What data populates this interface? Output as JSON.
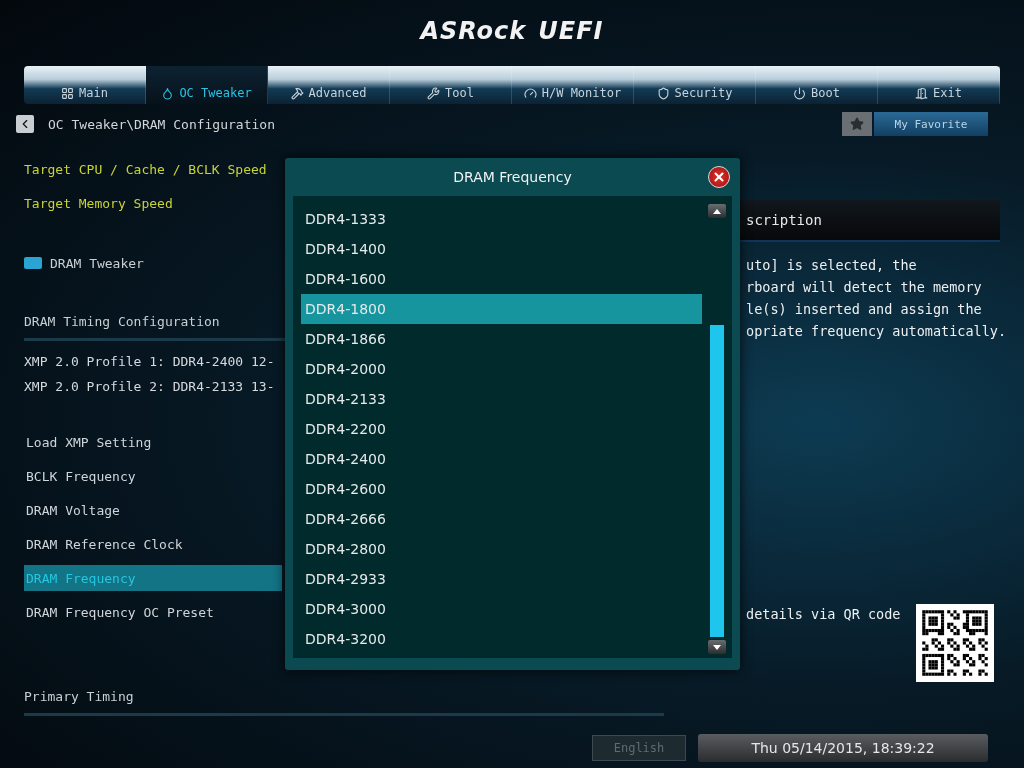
{
  "logo": {
    "brand": "ASRock",
    "product": "UEFI"
  },
  "tabs": [
    {
      "label": "Main",
      "selected": false
    },
    {
      "label": "OC Tweaker",
      "selected": true
    },
    {
      "label": "Advanced",
      "selected": false
    },
    {
      "label": "Tool",
      "selected": false
    },
    {
      "label": "H/W Monitor",
      "selected": false
    },
    {
      "label": "Security",
      "selected": false
    },
    {
      "label": "Boot",
      "selected": false
    },
    {
      "label": "Exit",
      "selected": false
    }
  ],
  "breadcrumb": "OC Tweaker\\DRAM Configuration",
  "favorite": {
    "label": "My Favorite"
  },
  "settings": [
    {
      "kind": "info",
      "label": "Target CPU / Cache / BCLK Speed"
    },
    {
      "kind": "info",
      "label": "Target Memory Speed"
    },
    {
      "kind": "submenu",
      "label": "DRAM Tweaker"
    },
    {
      "kind": "section",
      "label": "DRAM Timing Configuration"
    },
    {
      "kind": "text",
      "label": "XMP 2.0 Profile 1: DDR4-2400 12-"
    },
    {
      "kind": "text",
      "label": "XMP 2.0 Profile 2: DDR4-2133 13-"
    },
    {
      "kind": "option",
      "label": "Load XMP Setting",
      "selected": false
    },
    {
      "kind": "option",
      "label": "BCLK Frequency",
      "selected": false
    },
    {
      "kind": "option",
      "label": "DRAM Voltage",
      "selected": false
    },
    {
      "kind": "option",
      "label": "DRAM Reference Clock",
      "selected": false
    },
    {
      "kind": "option",
      "label": "DRAM Frequency",
      "selected": true
    },
    {
      "kind": "option",
      "label": "DRAM Frequency OC Preset",
      "selected": false
    },
    {
      "kind": "section",
      "label": "Primary Timing"
    }
  ],
  "description": {
    "title": "scription",
    "lines": [
      "uto] is selected, the",
      "rboard will detect the memory",
      "le(s) inserted and assign the",
      "opriate frequency automatically."
    ],
    "qr_caption": "details via QR code"
  },
  "dialog": {
    "title": "DRAM Frequency",
    "options": [
      {
        "label": "DDR4-1333",
        "selected": false
      },
      {
        "label": "DDR4-1400",
        "selected": false
      },
      {
        "label": "DDR4-1600",
        "selected": false
      },
      {
        "label": "DDR4-1800",
        "selected": true
      },
      {
        "label": "DDR4-1866",
        "selected": false
      },
      {
        "label": "DDR4-2000",
        "selected": false
      },
      {
        "label": "DDR4-2133",
        "selected": false
      },
      {
        "label": "DDR4-2200",
        "selected": false
      },
      {
        "label": "DDR4-2400",
        "selected": false
      },
      {
        "label": "DDR4-2600",
        "selected": false
      },
      {
        "label": "DDR4-2666",
        "selected": false
      },
      {
        "label": "DDR4-2800",
        "selected": false
      },
      {
        "label": "DDR4-2933",
        "selected": false
      },
      {
        "label": "DDR4-3000",
        "selected": false
      },
      {
        "label": "DDR4-3200",
        "selected": false
      }
    ]
  },
  "status_bar": {
    "language": "English",
    "datetime": "Thu 05/14/2015, 18:39:22"
  }
}
